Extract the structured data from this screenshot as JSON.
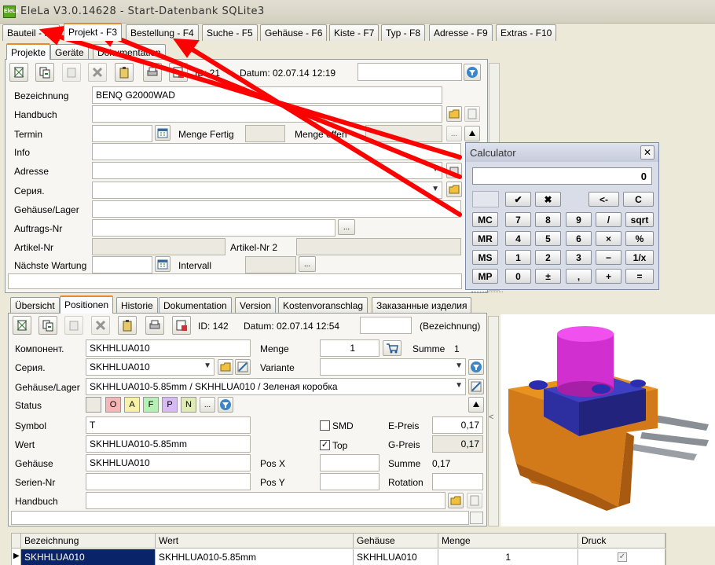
{
  "window": {
    "title": "EleLa V3.0.14628  - Start-Datenbank SQLite3",
    "icon_text": "EleLa"
  },
  "main_tabs": [
    "Bauteil - F2",
    "Projekt - F3",
    "Bestellung - F4",
    "Suche - F5",
    "Gehäuse - F6",
    "Kiste - F7",
    "Typ - F8",
    "Adresse - F9",
    "Extras - F10"
  ],
  "project_tabs": [
    "Projekte",
    "Geräte",
    "Dokumentation"
  ],
  "project": {
    "id_label": "ID: 21",
    "date_label": "Datum: 02.07.14 12:19",
    "labels": {
      "bezeichnung": "Bezeichnung",
      "handbuch": "Handbuch",
      "termin": "Termin",
      "menge_fertig": "Menge Fertig",
      "menge_offen": "Menge offen",
      "info": "Info",
      "adresse": "Adresse",
      "seria": "Серия.",
      "gehaeuse_lager": "Gehäuse/Lager",
      "auftrags_nr": "Auftrags-Nr",
      "artikel_nr": "Artikel-Nr",
      "artikel_nr2": "Artikel-Nr 2",
      "naechste_wartung": "Nächste Wartung",
      "intervall": "Intervall"
    },
    "bezeichnung_value": "BENQ G2000WAD",
    "dots": "..."
  },
  "calculator": {
    "title": "Calculator",
    "display": "0",
    "buttons": [
      [
        "✔",
        "✖",
        "<-",
        "C"
      ],
      [
        "MC",
        "7",
        "8",
        "9",
        "/",
        "sqrt"
      ],
      [
        "MR",
        "4",
        "5",
        "6",
        "×",
        "%"
      ],
      [
        "MS",
        "1",
        "2",
        "3",
        "−",
        "1/x"
      ],
      [
        "MP",
        "0",
        "±",
        ",",
        "+",
        "="
      ]
    ]
  },
  "lower_tabs": [
    "Übersicht",
    "Positionen",
    "Historie",
    "Dokumentation",
    "Version",
    "Kostenvoranschlag",
    "Заказанные изделия"
  ],
  "position": {
    "id_label": "ID: 142",
    "date_label": "Datum: 02.07.14 12:54",
    "bezeichnung_hint": "(Bezeichnung)",
    "labels": {
      "komponent": "Компонент.",
      "menge": "Menge",
      "summe": "Summe",
      "seria": "Серия.",
      "variante": "Variante",
      "gehaeuse_lager": "Gehäuse/Lager",
      "status": "Status",
      "symbol": "Symbol",
      "smd": "SMD",
      "e_preis": "E-Preis",
      "wert": "Wert",
      "top": "Top",
      "g_preis": "G-Preis",
      "gehaeuse": "Gehäuse",
      "pos_x": "Pos X",
      "summe2": "Summe",
      "serien_nr": "Serien-Nr",
      "pos_y": "Pos Y",
      "rotation": "Rotation",
      "handbuch": "Handbuch"
    },
    "komponent_value": "SKHHLUA010",
    "menge_value": "1",
    "summe_value": "1",
    "seria_value": "SKHHLUA010",
    "gehaeuse_lager_value": "SKHHLUA010-5.85mm / SKHHLUA010 / Зеленая коробка",
    "status_chips": [
      "O",
      "A",
      "F",
      "P",
      "N"
    ],
    "status_colors": [
      "#f7b5b5",
      "#f8f2a8",
      "#b5f1b5",
      "#d7b9f5",
      "#dfecb5"
    ],
    "symbol_value": "T",
    "e_preis_value": "0,17",
    "wert_value": "SKHHLUA010-5.85mm",
    "g_preis_value": "0,17",
    "gehaeuse_value": "SKHHLUA010",
    "summe2_value": "0,17",
    "smd_checked": false,
    "top_checked": true
  },
  "table": {
    "headers": [
      "Bezeichnung",
      "Wert",
      "Gehäuse",
      "Menge",
      "Druck"
    ],
    "rows": [
      {
        "bezeichnung": "SKHHLUA010",
        "wert": "SKHHLUA010-5.85mm",
        "gehaeuse": "SKHHLUA010",
        "menge": "1",
        "druck": true
      }
    ]
  },
  "colors": {
    "accent_tab": "#e68b2c",
    "annotation_arrow": "#ff0000",
    "selection": "#0a246a"
  }
}
